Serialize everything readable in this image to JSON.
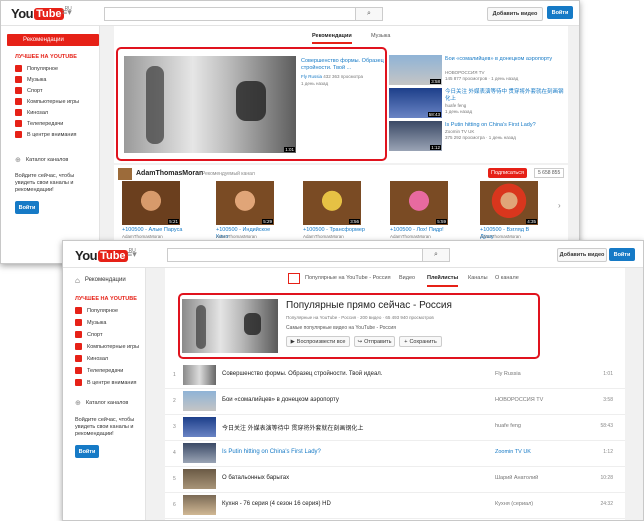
{
  "logo": {
    "you": "You",
    "tube": "Tube",
    "suffix": "RU"
  },
  "sidebar": {
    "recommendations": "Рекомендации",
    "best_header": "ЛУЧШЕЕ НА YOUTUBE",
    "items": [
      "Популярное",
      "Музыка",
      "Спорт",
      "Компьютерные игры",
      "Кинозал",
      "Телепередачи",
      "В центре внимания"
    ],
    "catalog": "Каталог каналов",
    "signin_note": "Войдите сейчас, чтобы увидеть свои каналы и рекомендации!",
    "signin_button": "Войти"
  },
  "top": {
    "upload_button": "Добавить видео",
    "signin_button": "Войти",
    "tabs": [
      "Рекомендации",
      "Музыка"
    ],
    "featured": {
      "title": "Совершенство формы. Образец стройности. Твой ...",
      "channel": "Fly Russia",
      "views": "432 363 просмотра",
      "age": "1 день назад",
      "duration": "1:01"
    },
    "side_videos": [
      {
        "title": "Бои «сомалийцев» в донецком аэропорту",
        "channel": "НОВОРОССИЯ TV",
        "meta": "145 877 просмотров · 1 день назад",
        "duration": "3:58"
      },
      {
        "title": "今日关注 外媒表演等待中 贯穿将外套就在刻画钢化上",
        "channel": "huafe feng",
        "meta": "1 день назад",
        "duration": "58:43"
      },
      {
        "title": "Is Putin hitting on China's First Lady?",
        "channel": "Zoomin TV UK",
        "meta": "375 292 просмотра · 1 день назад",
        "duration": "1:12"
      }
    ],
    "channel": {
      "name": "AdamThomasMoran",
      "tag": "Рекомендуемый канал",
      "subscribe": "Подписаться",
      "subs": "5 658 855"
    },
    "channel_videos": [
      {
        "title": "+100500 - Алые Паруса",
        "author": "AdamThomasMoran",
        "meta": "8 465 972 просмотра · 1 год назад",
        "duration": "5:21"
      },
      {
        "title": "+100500 - Индийское Кино",
        "author": "AdamThomasMoran",
        "meta": "8 415 910 просмотров · 2 года назад",
        "duration": "5:29"
      },
      {
        "title": "+100500 - Трансформер",
        "author": "AdamThomasMoran",
        "meta": "7 755 682 просмотра · 2 года назад",
        "duration": "3:56"
      },
      {
        "title": "+100500 - Лох! Пидр!",
        "author": "AdamThomasMoran",
        "meta": "7 570 942 просмотра · 3 года назад",
        "duration": "5:59"
      },
      {
        "title": "+100500 - Взгляд В Душу",
        "author": "AdamThomasMoran",
        "meta": "8 207 852 просмотра · 3 года назад",
        "duration": "4:35"
      }
    ]
  },
  "bottom": {
    "upload_button": "Добавить видео",
    "signin_button": "Войти",
    "channel_tabs": [
      "Популярные на YouTube - Россия",
      "Видео",
      "Плейлисты",
      "Каналы",
      "О канале"
    ],
    "playlist": {
      "title": "Популярные прямо сейчас - Россия",
      "meta": "Популярные на YouTube - Россия · 200 видео · 65 493 940 просмотров",
      "desc": "Самые популярные видео на YouTube - Россия",
      "play_all": "Воспроизвести все",
      "share": "Отправить",
      "save": "Сохранить"
    },
    "rows": [
      {
        "num": "1",
        "title": "Совершенство формы. Образец стройности. Твой идеал.",
        "channel": "Fly Russia",
        "duration": "1:01"
      },
      {
        "num": "2",
        "title": "Бои «сомалийцев» в донецком аэропорту",
        "channel": "НОВОРОССИЯ TV",
        "duration": "3:58"
      },
      {
        "num": "3",
        "title": "今日关注 外媒表演等待中 贯穿将外套就在刻画钢化上",
        "channel": "huafe feng",
        "duration": "58:43"
      },
      {
        "num": "4",
        "title": "Is Putin hitting on China's First Lady?",
        "channel": "Zoomin TV UK",
        "duration": "1:12"
      },
      {
        "num": "5",
        "title": "О батальонных барыгах",
        "channel": "Шарий Анатолий",
        "duration": "10:28"
      },
      {
        "num": "6",
        "title": "Кухня - 76 серия (4 сезон 16 серия) HD",
        "channel": "Кухня (сериал)",
        "duration": "24:32"
      }
    ]
  },
  "colors": {
    "accent": "#e62117",
    "link": "#167ac6",
    "highlight": "#e0131e"
  }
}
